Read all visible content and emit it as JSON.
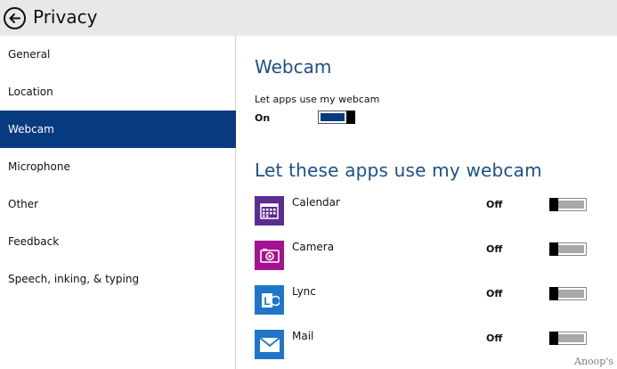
{
  "header": {
    "title": "Privacy",
    "back_icon": "back-arrow-icon"
  },
  "sidebar": {
    "items": [
      {
        "label": "General",
        "selected": false
      },
      {
        "label": "Location",
        "selected": false
      },
      {
        "label": "Webcam",
        "selected": true
      },
      {
        "label": "Microphone",
        "selected": false
      },
      {
        "label": "Other",
        "selected": false
      },
      {
        "label": "Feedback",
        "selected": false
      },
      {
        "label": "Speech, inking, & typing",
        "selected": false
      }
    ]
  },
  "main": {
    "title": "Webcam",
    "webcam_toggle": {
      "label": "Let apps use my webcam",
      "state": "On"
    },
    "apps_title": "Let these apps use my webcam",
    "apps": [
      {
        "name": "Calendar",
        "state": "Off",
        "icon": "calendar-icon",
        "color": "#5b2d91"
      },
      {
        "name": "Camera",
        "state": "Off",
        "icon": "camera-icon",
        "color": "#a4128f"
      },
      {
        "name": "Lync",
        "state": "Off",
        "icon": "lync-icon",
        "color": "#1f75c8"
      },
      {
        "name": "Mail",
        "state": "Off",
        "icon": "mail-icon",
        "color": "#1f75c8"
      }
    ]
  },
  "colors": {
    "accent": "#083a80",
    "title_blue": "#1e4f87",
    "header_bg": "#e8e8e8"
  },
  "watermark": "Anoop's"
}
